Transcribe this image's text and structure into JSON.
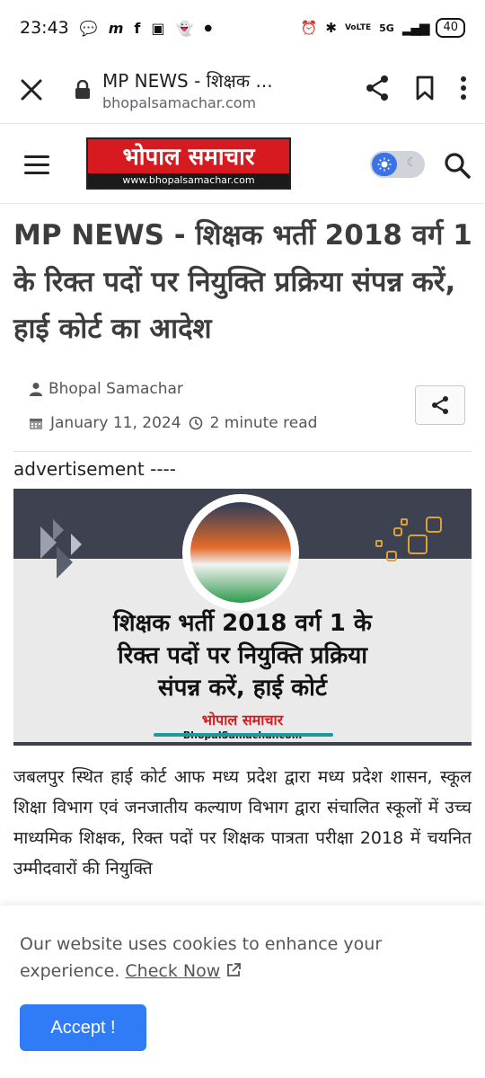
{
  "status_bar": {
    "time": "23:43",
    "network": "5G",
    "volte": "VoLTE",
    "battery": "40"
  },
  "browser": {
    "page_title": "MP NEWS - शिक्षक ...",
    "domain": "bhopalsamachar.com"
  },
  "site": {
    "logo_text": "भोपाल समाचार",
    "logo_url": "www.bhopalsamachar.com"
  },
  "article": {
    "title": "MP NEWS - शिक्षक भर्ती 2018 वर्ग 1 के रिक्त पदों पर नियुक्ति प्रक्रिया संपन्न करें, हाई कोर्ट का आदेश",
    "author": "Bhopal Samachar",
    "date": "January 11, 2024",
    "read_time": "2 minute read",
    "body": "जबलपुर स्थित हाई कोर्ट आफ मध्य प्रदेश द्वारा मध्य प्रदेश शासन, स्कूल शिक्षा विभाग एवं जनजातीय कल्याण विभाग द्वारा संचालित स्कूलों में उच्च माध्यमिक शिक्षक, रिक्त पदों पर शिक्षक पात्रता परीक्षा 2018 में चयनित उम्मीदवारों की नियुक्ति"
  },
  "ad": {
    "label": "advertisement ----",
    "headline_line1": "शिक्षक भर्ती 2018 वर्ग 1 के",
    "headline_line2": "रिक्त पदों पर नियुक्ति प्रक्रिया",
    "headline_line3": "संपन्न करें, हाई कोर्ट",
    "brand": "भोपाल समाचार",
    "brand_sub": "BhopalSamachar.com"
  },
  "cookie": {
    "message": "Our website uses cookies to enhance your experience.",
    "link_label": "Check Now",
    "accept_label": "Accept !"
  },
  "colors": {
    "brand_red": "#d71920",
    "accept_blue": "#2f7cf6",
    "toggle_blue": "#3b73e6"
  }
}
